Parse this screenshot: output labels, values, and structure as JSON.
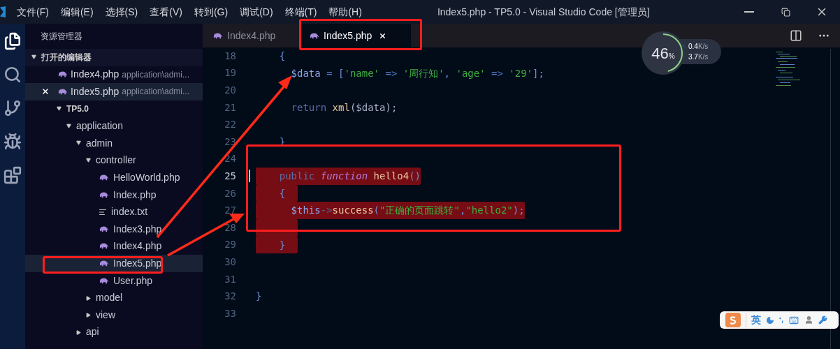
{
  "window": {
    "title": "Index5.php - TP5.0 - Visual Studio Code [管理员]"
  },
  "menu": [
    "文件(F)",
    "编辑(E)",
    "选择(S)",
    "查看(V)",
    "转到(G)",
    "调试(D)",
    "终端(T)",
    "帮助(H)"
  ],
  "activity_bar": [
    {
      "kind": "files",
      "selected": true
    },
    {
      "kind": "search",
      "selected": false
    },
    {
      "kind": "git",
      "selected": false
    },
    {
      "kind": "debug",
      "selected": false
    },
    {
      "kind": "extensions",
      "selected": false
    }
  ],
  "sidebar": {
    "title": "资源管理器",
    "open_editors": {
      "label": "打开的编辑器",
      "expanded": true,
      "items": [
        {
          "name": "Index4.php",
          "path": "application\\admi...",
          "selected": false
        },
        {
          "name": "Index5.php",
          "path": "application\\admi...",
          "selected": true
        }
      ]
    },
    "tree": [
      {
        "name": "TP5.0",
        "kind": "section",
        "expanded": true,
        "selected": false,
        "children": [
          {
            "name": "application",
            "kind": "folder",
            "expanded": true,
            "selected": false,
            "children": [
              {
                "name": "admin",
                "kind": "folder",
                "expanded": true,
                "selected": false,
                "children": [
                  {
                    "name": "controller",
                    "kind": "folder",
                    "expanded": true,
                    "selected": false,
                    "children": [
                      {
                        "name": "HelloWorld.php",
                        "kind": "php",
                        "selected": false
                      },
                      {
                        "name": "Index.php",
                        "kind": "php",
                        "selected": false
                      },
                      {
                        "name": "index.txt",
                        "kind": "txt",
                        "selected": false
                      },
                      {
                        "name": "Index3.php",
                        "kind": "php",
                        "selected": false
                      },
                      {
                        "name": "Index4.php",
                        "kind": "php",
                        "selected": false
                      },
                      {
                        "name": "Index5.php",
                        "kind": "php",
                        "selected": true
                      },
                      {
                        "name": "User.php",
                        "kind": "php",
                        "selected": false
                      }
                    ]
                  },
                  {
                    "name": "model",
                    "kind": "folder",
                    "expanded": false,
                    "selected": false
                  },
                  {
                    "name": "view",
                    "kind": "folder",
                    "expanded": false,
                    "selected": false
                  }
                ]
              },
              {
                "name": "api",
                "kind": "folder",
                "expanded": false,
                "selected": false
              }
            ]
          }
        ]
      }
    ]
  },
  "tabs": [
    {
      "label": "Index4.php",
      "selected": false
    },
    {
      "label": "Index5.php",
      "selected": true
    }
  ],
  "editor": {
    "lines": [
      {
        "number": "18",
        "selected": false,
        "current": false,
        "tokens": [
          {
            "text": "    {",
            "kind": "punc"
          }
        ]
      },
      {
        "number": "19",
        "selected": false,
        "current": false,
        "tokens": [
          {
            "text": "      $data",
            "kind": "var"
          },
          {
            "text": " = ",
            "kind": "op"
          },
          {
            "text": "[",
            "kind": "punc"
          },
          {
            "text": "'name'",
            "kind": "str"
          },
          {
            "text": " => ",
            "kind": "op"
          },
          {
            "text": "'周行知'",
            "kind": "str"
          },
          {
            "text": ", ",
            "kind": "punc"
          },
          {
            "text": "'age'",
            "kind": "str"
          },
          {
            "text": " => ",
            "kind": "op"
          },
          {
            "text": "'29'",
            "kind": "str"
          },
          {
            "text": "];",
            "kind": "punc"
          }
        ]
      },
      {
        "number": "20",
        "selected": false,
        "current": false
      },
      {
        "number": "21",
        "selected": false,
        "current": false,
        "tokens": [
          {
            "text": "      return",
            "kind": "kw"
          },
          {
            "text": " xml",
            "kind": "func"
          },
          {
            "text": "(",
            "kind": "plain"
          },
          {
            "text": "$data",
            "kind": "plain"
          },
          {
            "text": ");",
            "kind": "plain"
          }
        ]
      },
      {
        "number": "22",
        "selected": false,
        "current": false
      },
      {
        "number": "23",
        "selected": false,
        "current": false,
        "tokens": [
          {
            "text": "    }",
            "kind": "punc"
          }
        ]
      },
      {
        "number": "24",
        "selected": false,
        "current": false
      },
      {
        "number": "25",
        "selected": true,
        "current": true,
        "tokens": [
          {
            "text": "    public",
            "kind": "kw"
          },
          {
            "text": " function",
            "kind": "storage"
          },
          {
            "text": " hello4",
            "kind": "func"
          },
          {
            "text": "()",
            "kind": "punc"
          }
        ]
      },
      {
        "number": "26",
        "selected": true,
        "current": false,
        "tokens": [
          {
            "text": "    {",
            "kind": "punc"
          }
        ]
      },
      {
        "number": "27",
        "selected": true,
        "current": false,
        "tokens": [
          {
            "text": "      $this",
            "kind": "var"
          },
          {
            "text": "->",
            "kind": "arrow"
          },
          {
            "text": "success",
            "kind": "func"
          },
          {
            "text": "(",
            "kind": "punc"
          },
          {
            "text": "\"正确的页面跳转\"",
            "kind": "str"
          },
          {
            "text": ",",
            "kind": "punc"
          },
          {
            "text": "\"hello2\"",
            "kind": "str"
          },
          {
            "text": ");",
            "kind": "punc"
          }
        ]
      },
      {
        "number": "28",
        "selected": true,
        "current": false
      },
      {
        "number": "29",
        "selected": true,
        "current": false,
        "tokens": [
          {
            "text": "    }",
            "kind": "punc"
          }
        ]
      },
      {
        "number": "30",
        "selected": false,
        "current": false
      },
      {
        "number": "31",
        "selected": false,
        "current": false
      },
      {
        "number": "32",
        "selected": false,
        "current": false,
        "tokens": [
          {
            "text": "}",
            "kind": "punc"
          }
        ]
      },
      {
        "number": "33",
        "selected": false,
        "current": false
      }
    ]
  },
  "net_monitor": {
    "percent": "46",
    "unit": "%",
    "level": 0.46,
    "upload": "0.4",
    "upload_unit": "K/s",
    "download": "3.7",
    "download_unit": "K/s"
  },
  "ime_bar": {
    "mode": "英"
  }
}
